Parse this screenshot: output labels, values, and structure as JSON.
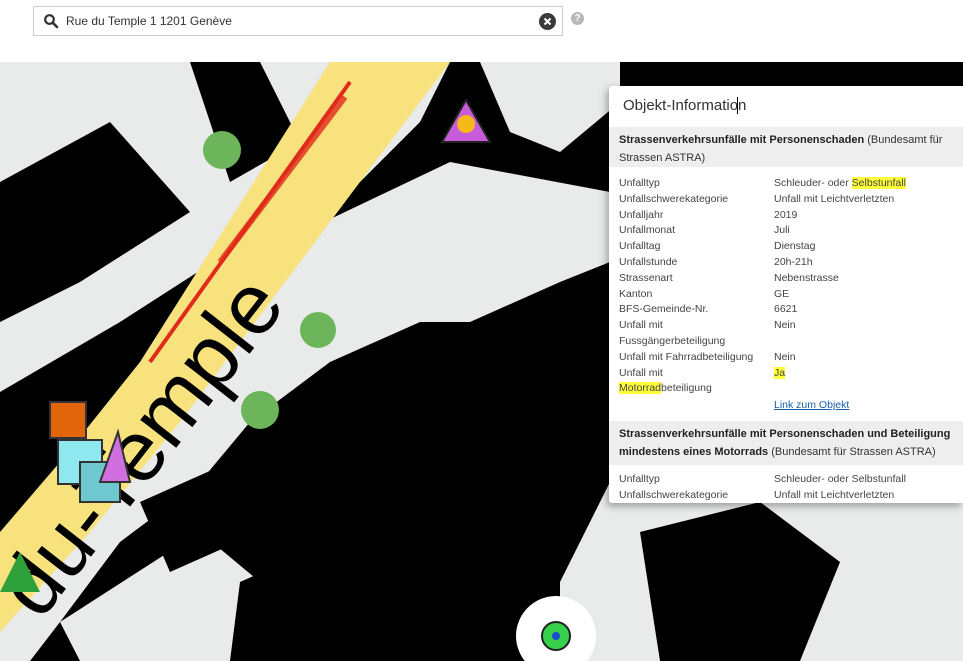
{
  "search": {
    "value": "Rue du Temple 1 1201 Genève",
    "help_glyph": "?"
  },
  "map": {
    "street_label": "du-Temple"
  },
  "panel": {
    "title": "Objekt-Information",
    "section1": {
      "title_bold": "Strassenverkehrsunfälle mit Personenschaden",
      "title_source": "(Bundesamt für Strassen ASTRA)",
      "rows": [
        {
          "key": "Unfalltyp",
          "value_plain": "Schleuder- oder ",
          "value_hl": "Selbstunfall"
        },
        {
          "key": "Unfallschwerekategorie",
          "value": "Unfall mit Leichtverletzten"
        },
        {
          "key": "Unfalljahr",
          "value": "2019"
        },
        {
          "key": "Unfallmonat",
          "value": "Juli"
        },
        {
          "key": "Unfalltag",
          "value": "Dienstag"
        },
        {
          "key": "Unfallstunde",
          "value": "20h-21h"
        },
        {
          "key": "Strassenart",
          "value": "Nebenstrasse"
        },
        {
          "key": "Kanton",
          "value": "GE"
        },
        {
          "key": "BFS-Gemeinde-Nr.",
          "value": "6621"
        },
        {
          "key": "Unfall mit Fussgängerbeteiligung",
          "value": "Nein"
        },
        {
          "key": "Unfall mit Fahrradbeteiligung",
          "value": "Nein"
        },
        {
          "key_line1": "Unfall mit",
          "key_line2_hl": "Motorrad",
          "key_line2_rest": "beteiligung",
          "value": "Ja"
        }
      ],
      "link": "Link zum Objekt"
    },
    "section2": {
      "title_bold": "Strassenverkehrsunfälle mit Personenschaden und Beteiligung mindestens eines Motorrads",
      "title_source": "(Bundesamt für Strassen ASTRA)",
      "rows": [
        {
          "key": "Unfalltyp",
          "value": "Schleuder- oder Selbstunfall"
        },
        {
          "key": "Unfallschwerekategorie",
          "value": "Unfall mit Leichtverletzten"
        }
      ]
    }
  },
  "colors": {
    "road": "#f7e27e",
    "building": "#000000",
    "land": "#e9eaea",
    "highlight": "#ffff3a",
    "link": "#1a5ea8"
  }
}
